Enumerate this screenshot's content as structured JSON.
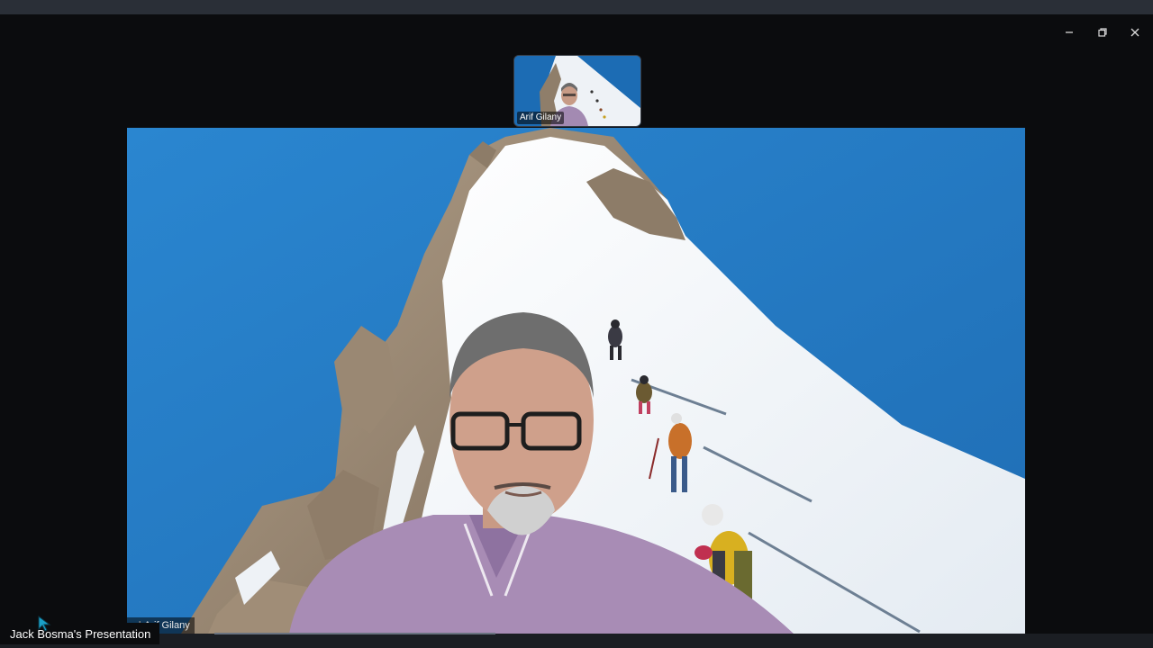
{
  "window": {
    "controls": {
      "minimize_icon": "minimize-icon",
      "restore_icon": "restore-icon",
      "close_icon": "close-icon"
    }
  },
  "thumbnail": {
    "participant_name": "Arif Gilany"
  },
  "main_video": {
    "participant_name": "Arif Gilany",
    "signal_icon": "signal-bars-icon"
  },
  "presentation": {
    "label": "Jack Bosma's Presentation"
  },
  "colors": {
    "sky": "#1f74bf",
    "snow": "#f3f6f9",
    "rock": "#9c8c78",
    "shirt": "#a68ab3",
    "background": "#0b0c0e"
  }
}
